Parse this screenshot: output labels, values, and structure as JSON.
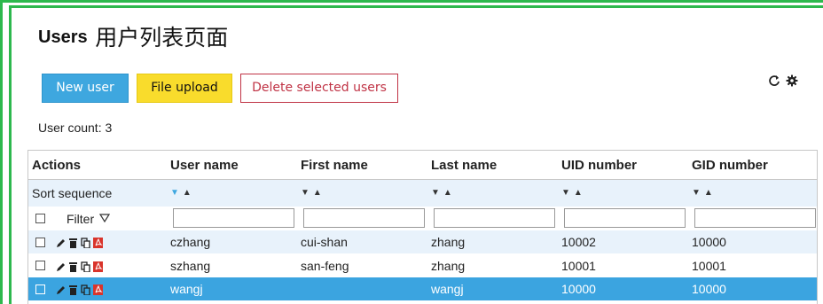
{
  "page": {
    "title_en": "Users",
    "title_cn": "用户列表页面"
  },
  "toolbar": {
    "new_user_label": "New user",
    "file_upload_label": "File upload",
    "delete_selected_label": "Delete selected users"
  },
  "count_text": "User count: 3",
  "table": {
    "columns": [
      "Actions",
      "User name",
      "First name",
      "Last name",
      "UID number",
      "GID number"
    ],
    "sort_label": "Sort sequence",
    "filter_label": "Filter",
    "rows": [
      {
        "user_name": "czhang",
        "first_name": "cui-shan",
        "last_name": "zhang",
        "uid": "10002",
        "gid": "10000"
      },
      {
        "user_name": "szhang",
        "first_name": "san-feng",
        "last_name": "zhang",
        "uid": "10001",
        "gid": "10001"
      },
      {
        "user_name": "wangj",
        "first_name": "",
        "last_name": "wangj",
        "uid": "10000",
        "gid": "10000",
        "selected": true
      }
    ]
  },
  "colors": {
    "accent_blue": "#3ea7df",
    "yellow": "#f9dc2c",
    "danger": "#c03345",
    "green_frame": "#2db84d",
    "selected_row": "#3ba4e0"
  }
}
